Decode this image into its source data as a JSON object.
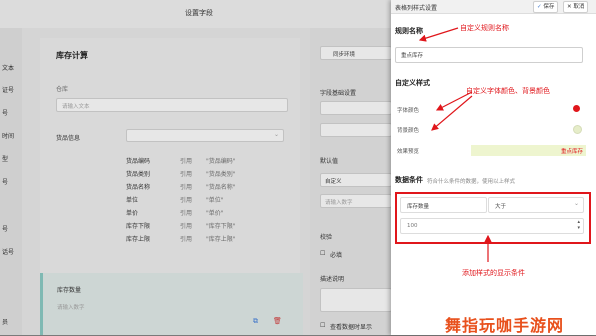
{
  "window": {
    "title": "设置字段"
  },
  "left_column": {
    "items": [
      "文本",
      "证号",
      "号",
      "时间",
      "型",
      "号",
      "号",
      "",
      "号",
      "话号",
      "员"
    ]
  },
  "main": {
    "card_title": "库存计算",
    "warehouse_label": "仓库",
    "warehouse_placeholder": "请输入文本",
    "product_info_label": "货品信息",
    "product_rows": [
      {
        "name": "货品编码",
        "action": "引用",
        "value": "\"货品编码\""
      },
      {
        "name": "货品类别",
        "action": "引用",
        "value": "\"货品类别\""
      },
      {
        "name": "货品名称",
        "action": "引用",
        "value": "\"货品名称\""
      },
      {
        "name": "单位",
        "action": "引用",
        "value": "\"单位\""
      },
      {
        "name": "单价",
        "action": "引用",
        "value": "\"单价\""
      },
      {
        "name": "库存下限",
        "action": "引用",
        "value": "\"库存下限\""
      },
      {
        "name": "库存上限",
        "action": "引用",
        "value": "\"库存上限\""
      }
    ],
    "stock_qty_label": "库存数量",
    "stock_qty_placeholder": "请输入数字"
  },
  "middle": {
    "sync_button": "同步环境",
    "field_base_label": "字段基础设置",
    "default_label": "默认值",
    "default_value": "自定义",
    "default_placeholder": "请输入数字",
    "check_label": "校验",
    "required_label": "必填",
    "desc_label": "描述说明",
    "show_label": "查看数据时显示"
  },
  "panel": {
    "title": "表格列样式设置",
    "save_button": "保存",
    "cancel_button": "取消",
    "rule_name_title": "规则名称",
    "rule_name_value": "重点库存",
    "custom_style_title": "自定义样式",
    "font_color_label": "字体颜色",
    "bg_color_label": "背景颜色",
    "preview_label": "效果预览",
    "preview_text": "重点库存",
    "font_color": "#e0161b",
    "bg_color": "#eef5cf",
    "conditions_title": "数据条件",
    "conditions_hint": "符合什么条件的数据，使用以上样式",
    "condition_field": "库存数量",
    "condition_operator": "大于",
    "condition_value": "100"
  },
  "annotations": {
    "custom_rule_name": "自定义规则名称",
    "custom_colors": "自定义字体颜色、背景颜色",
    "add_condition": "添加样式的显示条件"
  },
  "watermark": "舞指玩咖手游网"
}
